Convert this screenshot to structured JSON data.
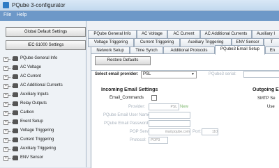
{
  "window": {
    "title": "PQube 3-configurator"
  },
  "menu": {
    "file": "File",
    "help": "Help"
  },
  "sidebar": {
    "global_defaults_button": "Global Default Settings",
    "iec_button": "IEC 61000 Settings",
    "tree": [
      "PQube General Info",
      "AC Voltage",
      "AC Current",
      "AC Additional Currents",
      "Auxiliary Inputs",
      "Relay Outputs",
      "Carbon",
      "Event Setup",
      "Voltage Triggering",
      "Current Triggering",
      "Auxiliary Triggering",
      "ENV Sensor"
    ]
  },
  "tabs": {
    "row1": [
      "PQube General Info",
      "AC Voltage",
      "AC Current",
      "AC Additional Currents",
      "Auxiliary I"
    ],
    "row2": [
      "Voltage Triggering",
      "Current Triggering",
      "Auxiliary Triggering",
      "ENV Sensor",
      "T"
    ],
    "row3": [
      "Network Setup",
      "Time Synch",
      "Additional Protocols",
      "PQube3 Email Setup",
      "En"
    ]
  },
  "panel": {
    "restore_defaults": "Restore Defaults",
    "provider_label": "Select email provider:",
    "provider_value": "PSL",
    "serial_label": "PQube3 serial:",
    "incoming_heading": "Incoming Email Settings",
    "outgoing_heading": "Outgoing E",
    "email_commands_label": "Email_Commands",
    "provider_field_label": "Provider:",
    "provider_field_value": "PSL",
    "provider_field_suffix": "New",
    "username_label": "PQube Email User Name:",
    "password_label": "PQube Email Password:",
    "pop_server_label": "POP Server:",
    "pop_server_value": "mail.pqube.com",
    "port_label": "Port:",
    "port_value": "110",
    "protocol_label": "Protocol:",
    "protocol_value": "POP3",
    "smtp_label": "SMTP Se",
    "user_label": "Use"
  },
  "colors": {
    "menubar": "#6d98c8",
    "accent": "#2e7bc4"
  }
}
